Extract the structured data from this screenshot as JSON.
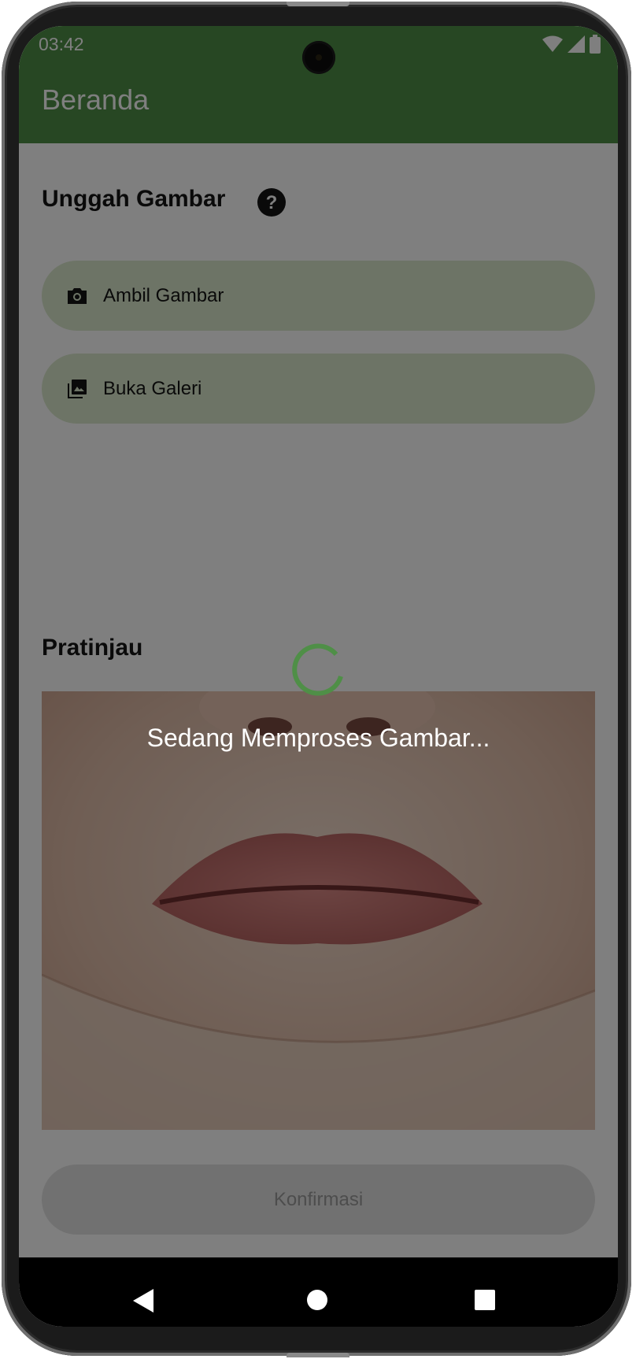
{
  "status_bar": {
    "time": "03:42"
  },
  "app_bar": {
    "title": "Beranda"
  },
  "upload_section": {
    "title": "Unggah Gambar",
    "help_icon": "help-circle-icon",
    "buttons": [
      {
        "label": "Ambil Gambar",
        "icon": "camera-icon"
      },
      {
        "label": "Buka Galeri",
        "icon": "photo-library-icon"
      }
    ]
  },
  "preview_section": {
    "title": "Pratinjau"
  },
  "confirm": {
    "label": "Konfirmasi"
  },
  "loading": {
    "message": "Sedang Memproses Gambar..."
  },
  "colors": {
    "primary": "#4f8f47",
    "button_fill": "#dbe9cd",
    "dim_overlay": "rgba(0,0,0,0.5)"
  },
  "nav_icons": [
    "back-icon",
    "home-icon",
    "recent-apps-icon"
  ]
}
